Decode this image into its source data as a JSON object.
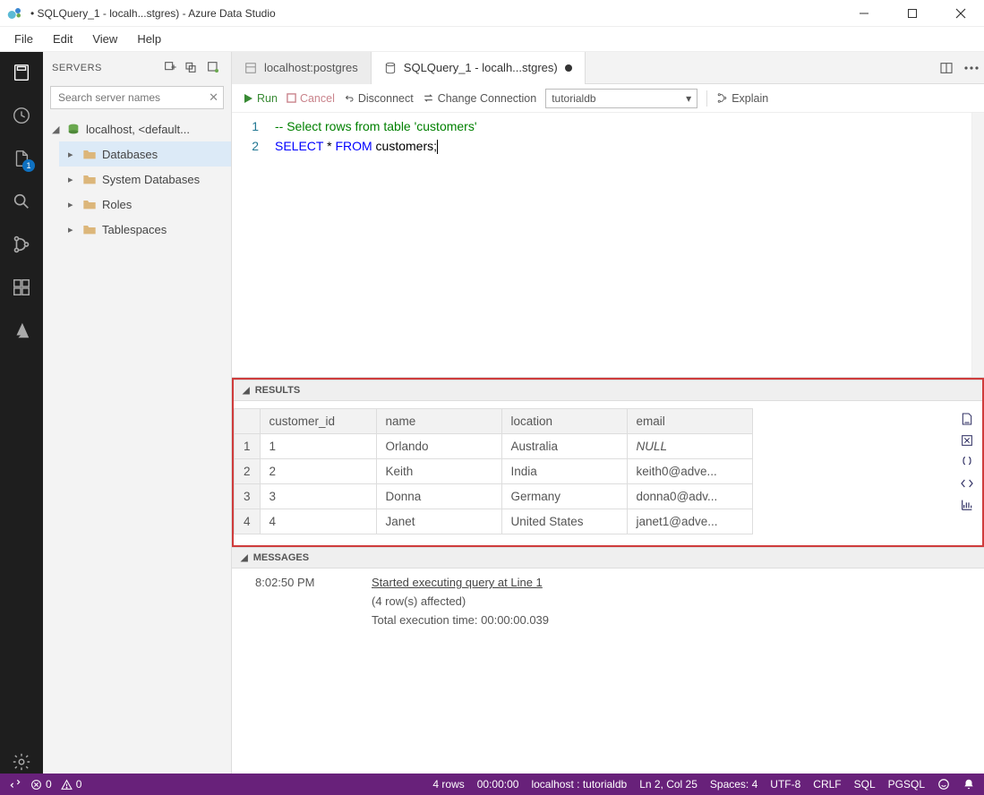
{
  "window": {
    "title": "• SQLQuery_1 - localh...stgres) - Azure Data Studio"
  },
  "menus": {
    "file": "File",
    "edit": "Edit",
    "view": "View",
    "help": "Help"
  },
  "activity": {
    "explorerBadge": "1"
  },
  "sidebar": {
    "title": "SERVERS",
    "search_placeholder": "Search server names",
    "server_label": "localhost, <default...",
    "items": [
      {
        "label": "Databases"
      },
      {
        "label": "System Databases"
      },
      {
        "label": "Roles"
      },
      {
        "label": "Tablespaces"
      }
    ]
  },
  "tabs": {
    "tab1": "localhost:postgres",
    "tab2": "SQLQuery_1 - localh...stgres)"
  },
  "toolbar": {
    "run": "Run",
    "cancel": "Cancel",
    "disconnect": "Disconnect",
    "changeconn": "Change Connection",
    "db": "tutorialdb",
    "explain": "Explain"
  },
  "editor": {
    "l1num": "1",
    "l2num": "2",
    "comment": "-- Select rows from table 'customers'",
    "kw_select": "SELECT",
    "star": " * ",
    "kw_from": "FROM",
    "ident": " customers;"
  },
  "results": {
    "header": "RESULTS",
    "cols": {
      "c1": "customer_id",
      "c2": "name",
      "c3": "location",
      "c4": "email"
    },
    "rows": [
      {
        "n": "1",
        "id": "1",
        "name": "Orlando",
        "loc": "Australia",
        "email": "NULL",
        "null": true
      },
      {
        "n": "2",
        "id": "2",
        "name": "Keith",
        "loc": "India",
        "email": "keith0@adve..."
      },
      {
        "n": "3",
        "id": "3",
        "name": "Donna",
        "loc": "Germany",
        "email": "donna0@adv..."
      },
      {
        "n": "4",
        "id": "4",
        "name": "Janet",
        "loc": "United States",
        "email": "janet1@adve..."
      }
    ]
  },
  "messages": {
    "header": "MESSAGES",
    "time": "8:02:50 PM",
    "line1": "Started executing query at Line 1",
    "line2": "(4 row(s) affected)",
    "line3": "Total execution time: 00:00:00.039"
  },
  "status": {
    "errors": "0",
    "warnings": "0",
    "rows": "4 rows",
    "elapsed": "00:00:00",
    "conn": "localhost : tutorialdb",
    "pos": "Ln 2, Col 25",
    "spaces": "Spaces: 4",
    "enc": "UTF-8",
    "eol": "CRLF",
    "lang": "SQL",
    "ext": "PGSQL"
  }
}
